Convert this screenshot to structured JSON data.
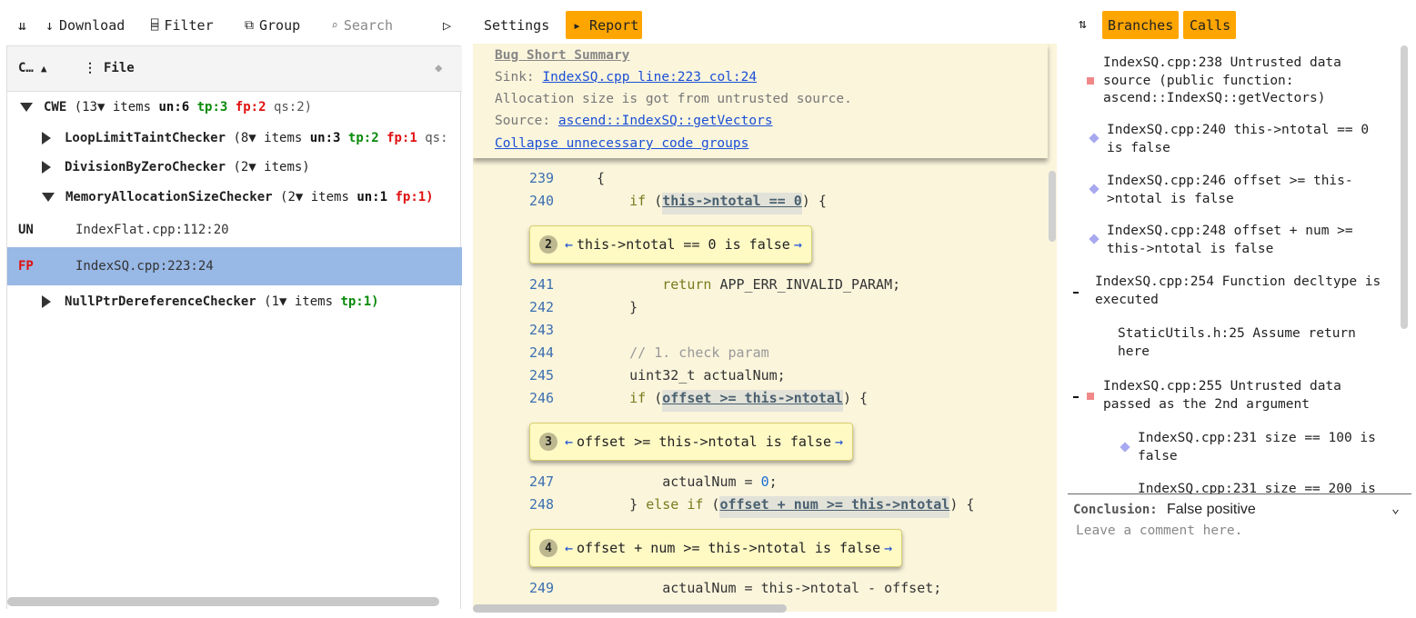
{
  "toolbar": {
    "sort_icon": "⇊",
    "download_label": "Download",
    "filter_label": "Filter",
    "group_label": "Group",
    "search_placeholder": "Search",
    "run_icon": "▷"
  },
  "grid": {
    "col_checker": "C…",
    "col_file": "File",
    "rows": {
      "cwe": {
        "name": "CWE",
        "count": "(13▼ items",
        "un": "un:6",
        "tp": "tp:3",
        "fp": "fp:2",
        "qs": "qs:2)"
      },
      "loop": {
        "name": "LoopLimitTaintChecker",
        "count": "(8▼ items",
        "un": "un:3",
        "tp": "tp:2",
        "fp": "fp:1",
        "qs": "qs:"
      },
      "div": {
        "name": "DivisionByZeroChecker",
        "count": "(2▼ items)"
      },
      "mem": {
        "name": "MemoryAllocationSizeChecker",
        "count": "(2▼ items",
        "un": "un:1",
        "fp": "fp:1)"
      },
      "leaf1": {
        "status": "UN",
        "file": "IndexFlat.cpp:112:20"
      },
      "leaf2": {
        "status": "FP",
        "file": "IndexSQ.cpp:223:24"
      },
      "nullp": {
        "name": "NullPtrDereferenceChecker",
        "count": "(1▼ items",
        "tp": "tp:1)"
      }
    }
  },
  "middle": {
    "settings_label": "Settings",
    "report_label": "▸ Report",
    "summary": {
      "title": "Bug Short Summary",
      "sink_label": "Sink:",
      "sink_link": "IndexSQ.cpp line:223 col:24",
      "message": "Allocation size is got from untrusted source.",
      "source_label": "Source:",
      "source_link": "ascend::IndexSQ::getVectors",
      "collapse_link": "Collapse unnecessary code groups"
    },
    "code": {
      "l239": {
        "no": "239",
        "text": "{"
      },
      "l240": {
        "no": "240",
        "kw": "if",
        "open": " (",
        "hl": "this->ntotal == 0",
        "close": ") {"
      },
      "b2": {
        "n": "2",
        "text": "this->ntotal == 0 is false"
      },
      "l241": {
        "no": "241",
        "kw": "return",
        "rest": " APP_ERR_INVALID_PARAM;"
      },
      "l242": {
        "no": "242",
        "text": "}"
      },
      "l243": {
        "no": "243",
        "text": ""
      },
      "l244": {
        "no": "244",
        "text": "// 1. check param"
      },
      "l245": {
        "no": "245",
        "text": "uint32_t actualNum;"
      },
      "l246": {
        "no": "246",
        "kw": "if",
        "open": " (",
        "hl": "offset >= this->ntotal",
        "close": ") {"
      },
      "b3": {
        "n": "3",
        "text": "offset >= this->ntotal is false"
      },
      "l247": {
        "no": "247",
        "pre": "actualNum = ",
        "num": "0",
        "post": ";"
      },
      "l248": {
        "no": "248",
        "pre": "} ",
        "kw": "else if",
        "open": " (",
        "hl": "offset + num >= this->ntotal",
        "close": ") {"
      },
      "b4": {
        "n": "4",
        "text": "offset + num >= this->ntotal is false"
      },
      "l249": {
        "no": "249",
        "text": "actualNum = this->ntotal - offset;"
      }
    }
  },
  "right": {
    "sort_icon": "⇅",
    "branches_label": "Branches",
    "calls_label": "Calls",
    "trace": [
      {
        "text": "IndexSQ.cpp:238 Untrusted data source (public function: ascend::IndexSQ::getVectors)"
      },
      {
        "text": "IndexSQ.cpp:240 this->ntotal == 0 is false"
      },
      {
        "text": "IndexSQ.cpp:246 offset >= this->ntotal is false"
      },
      {
        "text": "IndexSQ.cpp:248 offset + num >= this->ntotal is false"
      },
      {
        "text": "IndexSQ.cpp:254 Function decltype is executed"
      },
      {
        "text": "StaticUtils.h:25 Assume return here"
      },
      {
        "text": "IndexSQ.cpp:255 Untrusted data passed as the 2nd argument"
      },
      {
        "text": "IndexSQ.cpp:231 size == 100 is false"
      },
      {
        "text": "IndexSQ.cpp:231 size == 200 is"
      }
    ],
    "conclusion_label": "Conclusion:",
    "conclusion_value": "False positive",
    "comment_placeholder": "Leave a comment here."
  }
}
